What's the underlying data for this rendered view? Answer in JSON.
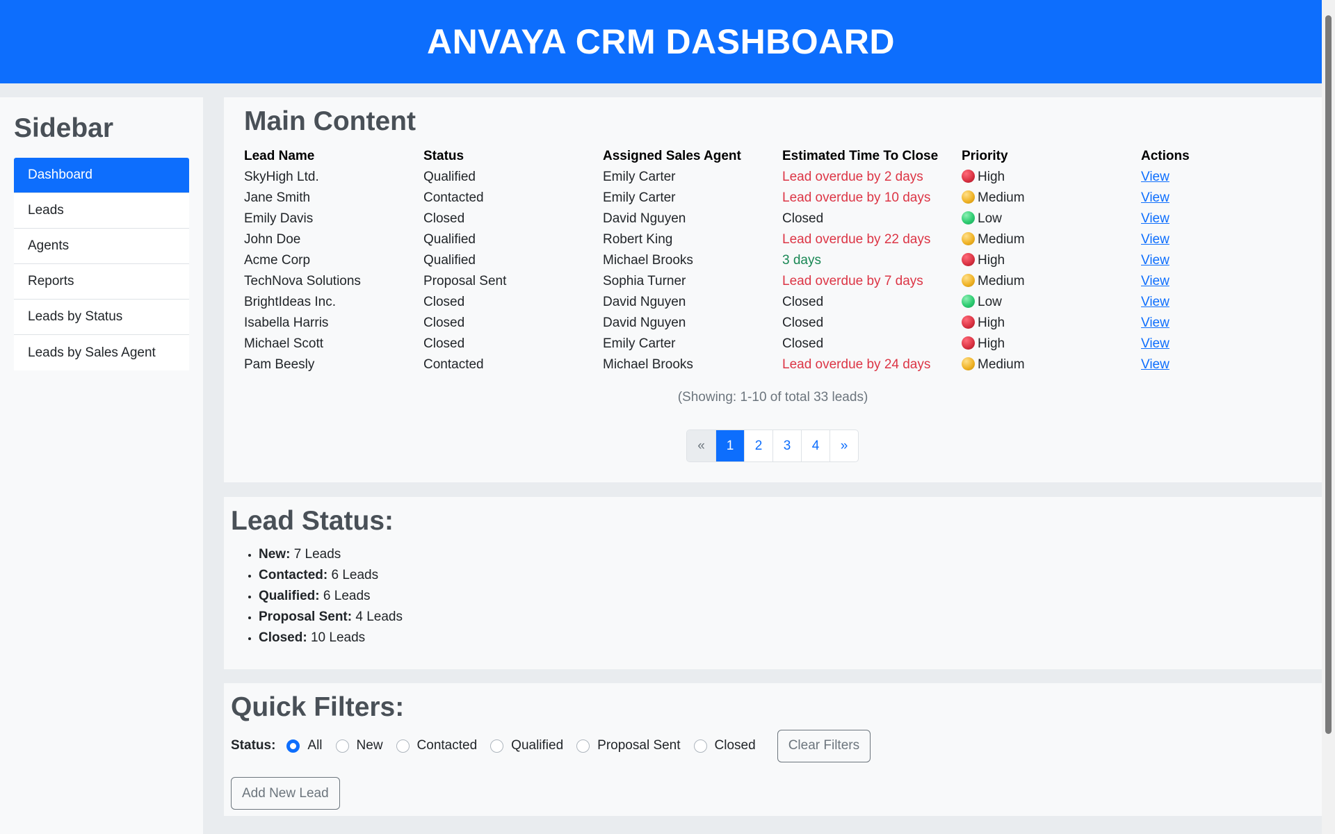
{
  "header": {
    "title": "ANVAYA CRM DASHBOARD"
  },
  "sidebar": {
    "title": "Sidebar",
    "items": [
      {
        "label": "Dashboard",
        "active": true
      },
      {
        "label": "Leads"
      },
      {
        "label": "Agents"
      },
      {
        "label": "Reports"
      },
      {
        "label": "Leads by Status"
      },
      {
        "label": "Leads by Sales Agent"
      }
    ]
  },
  "main": {
    "title": "Main Content",
    "columns": [
      "Lead Name",
      "Status",
      "Assigned Sales Agent",
      "Estimated Time To Close",
      "Priority",
      "Actions"
    ],
    "rows": [
      {
        "name": "SkyHigh Ltd.",
        "status": "Qualified",
        "agent": "Emily Carter",
        "time": "Lead overdue by 2 days",
        "time_state": "overdue",
        "priority": "High",
        "action": "View"
      },
      {
        "name": "Jane Smith",
        "status": "Contacted",
        "agent": "Emily Carter",
        "time": "Lead overdue by 10 days",
        "time_state": "overdue",
        "priority": "Medium",
        "action": "View"
      },
      {
        "name": "Emily Davis",
        "status": "Closed",
        "agent": "David Nguyen",
        "time": "Closed",
        "time_state": "closed",
        "priority": "Low",
        "action": "View"
      },
      {
        "name": "John Doe",
        "status": "Qualified",
        "agent": "Robert King",
        "time": "Lead overdue by 22 days",
        "time_state": "overdue",
        "priority": "Medium",
        "action": "View"
      },
      {
        "name": "Acme Corp",
        "status": "Qualified",
        "agent": "Michael Brooks",
        "time": "3 days",
        "time_state": "ontime",
        "priority": "High",
        "action": "View"
      },
      {
        "name": "TechNova Solutions",
        "status": "Proposal Sent",
        "agent": "Sophia Turner",
        "time": "Lead overdue by 7 days",
        "time_state": "overdue",
        "priority": "Medium",
        "action": "View"
      },
      {
        "name": "BrightIdeas Inc.",
        "status": "Closed",
        "agent": "David Nguyen",
        "time": "Closed",
        "time_state": "closed",
        "priority": "Low",
        "action": "View"
      },
      {
        "name": "Isabella Harris",
        "status": "Closed",
        "agent": "David Nguyen",
        "time": "Closed",
        "time_state": "closed",
        "priority": "High",
        "action": "View"
      },
      {
        "name": "Michael Scott",
        "status": "Closed",
        "agent": "Emily Carter",
        "time": "Closed",
        "time_state": "closed",
        "priority": "High",
        "action": "View"
      },
      {
        "name": "Pam Beesly",
        "status": "Contacted",
        "agent": "Michael Brooks",
        "time": "Lead overdue by 24 days",
        "time_state": "overdue",
        "priority": "Medium",
        "action": "View"
      }
    ],
    "showing": "(Showing: 1-10 of total 33 leads)",
    "pagination": {
      "prev": "«",
      "pages": [
        "1",
        "2",
        "3",
        "4"
      ],
      "current": "1",
      "next": "»"
    }
  },
  "lead_status": {
    "title": "Lead Status:",
    "items": [
      {
        "label": "New:",
        "value": "7 Leads"
      },
      {
        "label": "Contacted:",
        "value": "6 Leads"
      },
      {
        "label": "Qualified:",
        "value": "6 Leads"
      },
      {
        "label": "Proposal Sent:",
        "value": "4 Leads"
      },
      {
        "label": "Closed:",
        "value": "10 Leads"
      }
    ]
  },
  "filters": {
    "title": "Quick Filters:",
    "status_label": "Status:",
    "options": [
      "All",
      "New",
      "Contacted",
      "Qualified",
      "Proposal Sent",
      "Closed"
    ],
    "selected": "All",
    "clear_label": "Clear Filters",
    "add_label": "Add New Lead"
  },
  "colors": {
    "primary": "#0d6efd",
    "overdue": "#dc3545",
    "ontime": "#198754",
    "priority_high": "#dc3545",
    "priority_medium": "#f0b429",
    "priority_low": "#2ecc71"
  }
}
